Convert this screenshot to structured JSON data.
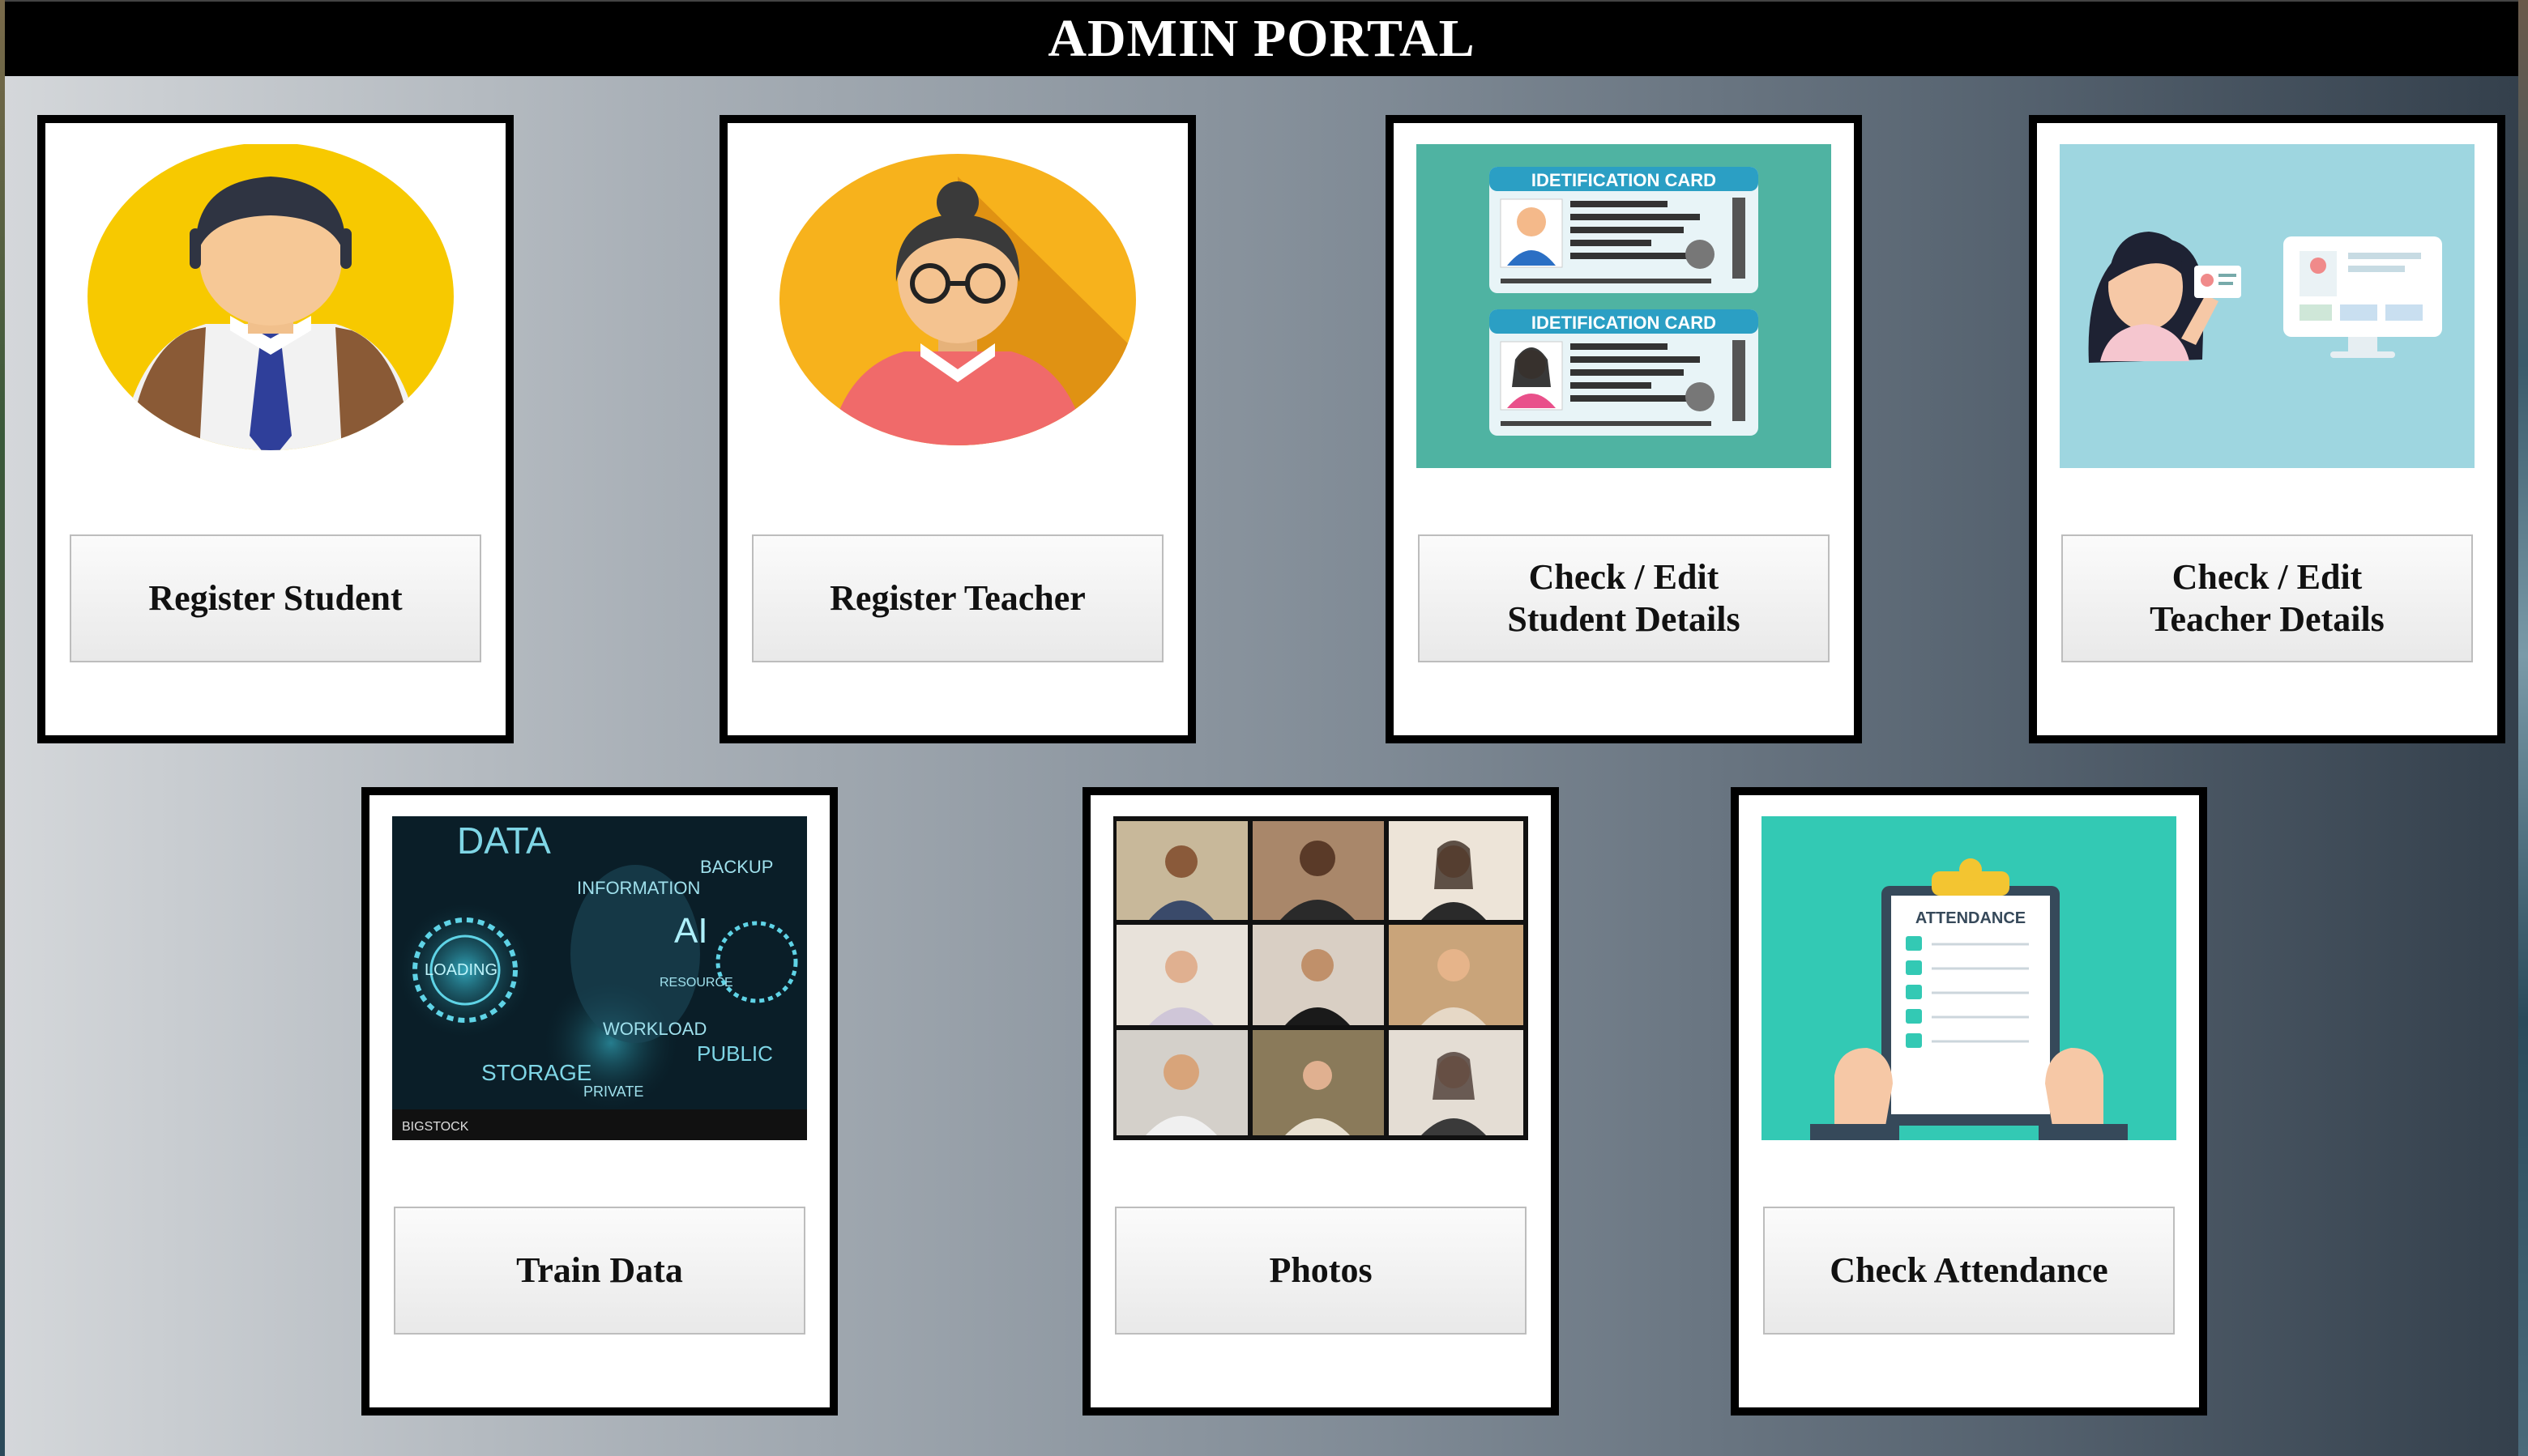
{
  "header": {
    "title": "ADMIN PORTAL"
  },
  "cards": [
    {
      "label": "Register Student",
      "image": "student-avatar"
    },
    {
      "label": "Register Teacher",
      "image": "teacher-avatar"
    },
    {
      "label": "Check / Edit\nStudent Details",
      "image": "id-cards",
      "card_caption": "IDETIFICATION CARD"
    },
    {
      "label": "Check / Edit\nTeacher Details",
      "image": "teacher-id-illustration"
    },
    {
      "label": "Train Data",
      "image": "data-ai-collage",
      "words": [
        "DATA",
        "INFORMATION",
        "BACKUP",
        "AI",
        "LOADING",
        "RESOURCE",
        "WORKLOAD",
        "STORAGE",
        "PUBLIC",
        "PRIVATE",
        "BIGSTOCK"
      ]
    },
    {
      "label": "Photos",
      "image": "video-call-grid"
    },
    {
      "label": "Check Attendance",
      "image": "attendance-clipboard",
      "clipboard_title": "ATTENDANCE"
    }
  ],
  "colors": {
    "titlebar": "#000000",
    "card_border": "#000000",
    "student_circle": "#f7c900",
    "teacher_circle": "#f7b21c",
    "id_bg": "#4fb3a2",
    "attendance_bg": "#33c9b4",
    "teacher_id_bg": "#9ed6e0"
  }
}
